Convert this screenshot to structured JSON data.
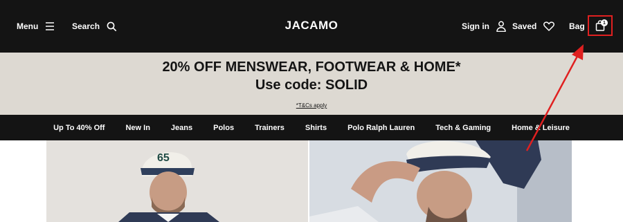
{
  "header": {
    "menu_label": "Menu",
    "search_label": "Search",
    "logo_text": "JACAMO",
    "signin_label": "Sign in",
    "saved_label": "Saved",
    "bag_label": "Bag",
    "bag_count": "1"
  },
  "promo": {
    "line1": "20% OFF MENSWEAR, FOOTWEAR & HOME*",
    "line2": "Use code: SOLID",
    "terms": "*T&Cs apply"
  },
  "nav": {
    "items": [
      "Up To 40% Off",
      "New In",
      "Jeans",
      "Polos",
      "Trainers",
      "Shirts",
      "Polo Ralph Lauren",
      "Tech & Gaming",
      "Home & Leisure"
    ]
  },
  "hero": {
    "left_cap_text": "65"
  },
  "colors": {
    "header_bg": "#141414",
    "promo_bg": "#ddd9d2",
    "annotation_red": "#e02020"
  }
}
